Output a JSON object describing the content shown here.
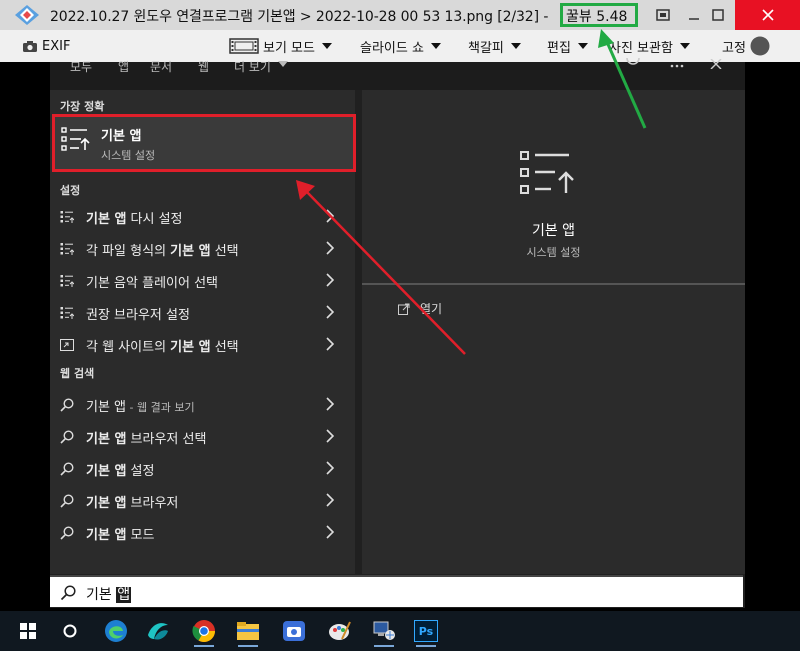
{
  "window": {
    "title": "2022.10.27 윈도우 연결프로그램 기본앱 > 2022-10-28 00 53 13.png [2/32] -",
    "version": "꿀뷰 5.48"
  },
  "menubar": {
    "exif": "EXIF",
    "view_mode": "보기 모드",
    "slideshow": "슬라이드 쇼",
    "bookmark": "책갈피",
    "edit": "편집",
    "photo_storage": "사진 보관함",
    "pin": "고정"
  },
  "search": {
    "tabs": [
      "모두",
      "앱",
      "문서",
      "웹",
      "더 보기"
    ],
    "best_match_header": "가장 정확",
    "best_match": {
      "title": "기본 앱",
      "subtitle": "시스템 설정"
    },
    "settings_header": "설정",
    "settings_items": [
      {
        "label": "기본 앱 다시 설정"
      },
      {
        "label": "각 파일 형식의 기본 앱 선택"
      },
      {
        "label": "기본 음악 플레이어 선택"
      },
      {
        "label": "권장 브라우저 설정"
      },
      {
        "label": "각 웹 사이트의 기본 앱 선택"
      }
    ],
    "web_header": "웹 검색",
    "web_items": [
      {
        "label": "기본 앱",
        "suffix": " - 웹 결과 보기"
      },
      {
        "label": "기본 앱 브라우저 선택"
      },
      {
        "label": "기본 앱 설정"
      },
      {
        "label": "기본 앱 브라우저"
      },
      {
        "label": "기본 앱 모드"
      }
    ],
    "preview": {
      "title": "기본 앱",
      "subtitle": "시스템 설정",
      "open_label": "열기"
    },
    "query_prefix": "기본 ",
    "query_selected": "앱"
  },
  "annotations": {
    "box_color_red": "#e01f2a",
    "box_color_green": "#22aa44"
  },
  "taskbar": {
    "icons": [
      "windows-start-icon",
      "search-circle-icon",
      "edge-icon",
      "app-icon",
      "chrome-icon",
      "file-explorer-icon",
      "camera-app-icon",
      "paint-icon",
      "network-icon",
      "photoshop-icon"
    ],
    "photoshop_label": "Ps"
  }
}
